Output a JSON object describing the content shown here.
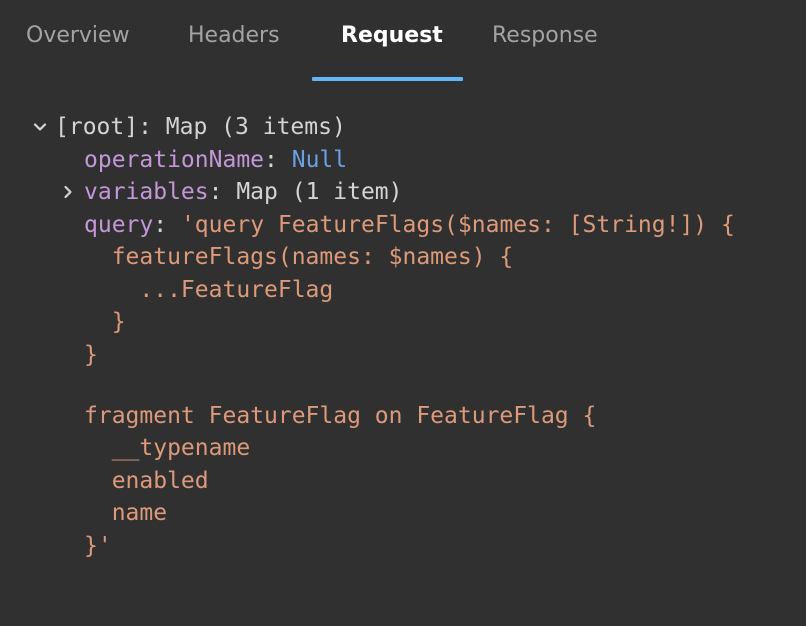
{
  "tabs": [
    {
      "label": "Overview",
      "active": false
    },
    {
      "label": "Headers",
      "active": false
    },
    {
      "label": "Request",
      "active": true
    },
    {
      "label": "Response",
      "active": false
    }
  ],
  "tree": {
    "root": {
      "key": "[root]",
      "sep": ": ",
      "summary": "Map (3 items)",
      "expanded": true,
      "icon": "chevron-down-icon"
    },
    "operationName": {
      "key": "operationName",
      "sep": ": ",
      "value": "Null"
    },
    "variables": {
      "key": "variables",
      "sep": ": ",
      "summary": "Map (1 item)",
      "expanded": false,
      "icon": "chevron-right-icon"
    },
    "query": {
      "key": "query",
      "sep": ": ",
      "lines": [
        "'query FeatureFlags($names: [String!]) {",
        "  featureFlags(names: $names) {",
        "    ...FeatureFlag",
        "  }",
        "}",
        "",
        "fragment FeatureFlag on FeatureFlag {",
        "  __typename",
        "  enabled",
        "  name",
        "}'"
      ]
    }
  },
  "colors": {
    "background": "#303030",
    "tab_active": "#ffffff",
    "tab_inactive": "#a3a3a3",
    "indicator": "#64b5f6",
    "key": "#c397d8",
    "null": "#6aa1e0",
    "string": "#dd9a7a",
    "plain": "#d4d4d4"
  }
}
